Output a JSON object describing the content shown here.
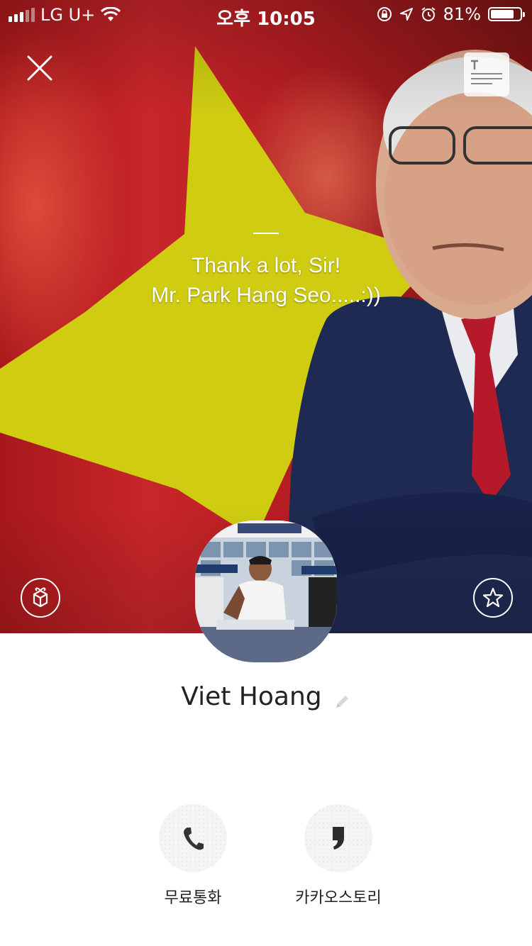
{
  "status_bar": {
    "carrier": "LG U+",
    "time": "오후 10:05",
    "battery_percent": "81%",
    "battery_level": 0.81
  },
  "profile": {
    "status_message_lines": [
      "Thank a lot, Sir!",
      "Mr. Park Hang Seo.....:))"
    ],
    "name": "Viet Hoang"
  },
  "actions": [
    {
      "label": "무료통화",
      "icon": "phone-icon"
    },
    {
      "label": "카카오스토리",
      "icon": "kakaostory-icon"
    }
  ],
  "header": {
    "close_icon": "close-icon",
    "text_icon": "text-icon"
  },
  "colors": {
    "cover_red": "#b41d22",
    "star_yellow": "#cfcc12",
    "suit_navy": "#1f2a52",
    "tie_red": "#b5192a"
  }
}
